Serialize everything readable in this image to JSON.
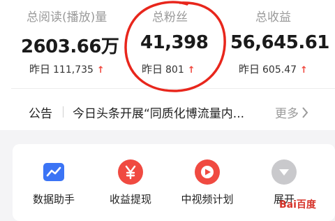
{
  "stats": [
    {
      "label": "总阅读(播放)量",
      "value": "2603.66万",
      "yesterday_label": "昨日",
      "yesterday_value": "111,735",
      "trend": "↑"
    },
    {
      "label": "总粉丝",
      "value": "41,398",
      "yesterday_label": "昨日",
      "yesterday_value": "801",
      "trend": "↑"
    },
    {
      "label": "总收益",
      "value": "56,645.61",
      "yesterday_label": "昨日",
      "yesterday_value": "605.47",
      "trend": "↑"
    }
  ],
  "notice": {
    "label": "公告",
    "text": "今日头条开展“同质化博流量内...",
    "more": "更多"
  },
  "tools": [
    {
      "label": "数据助手",
      "icon": "chart-icon",
      "color": "#3b74f5"
    },
    {
      "label": "收益提现",
      "icon": "yen-icon",
      "color": "#f04a41"
    },
    {
      "label": "中视频计划",
      "icon": "play-icon",
      "color": "#f04a41"
    },
    {
      "label": "展开",
      "icon": "chevron-down-icon",
      "color": "#c9c9cc"
    }
  ],
  "watermark": {
    "text": "Bai百度",
    "paw": "🐾"
  },
  "colors": {
    "accent_red": "#f0463c",
    "annotation_circle": "#e8261c"
  }
}
